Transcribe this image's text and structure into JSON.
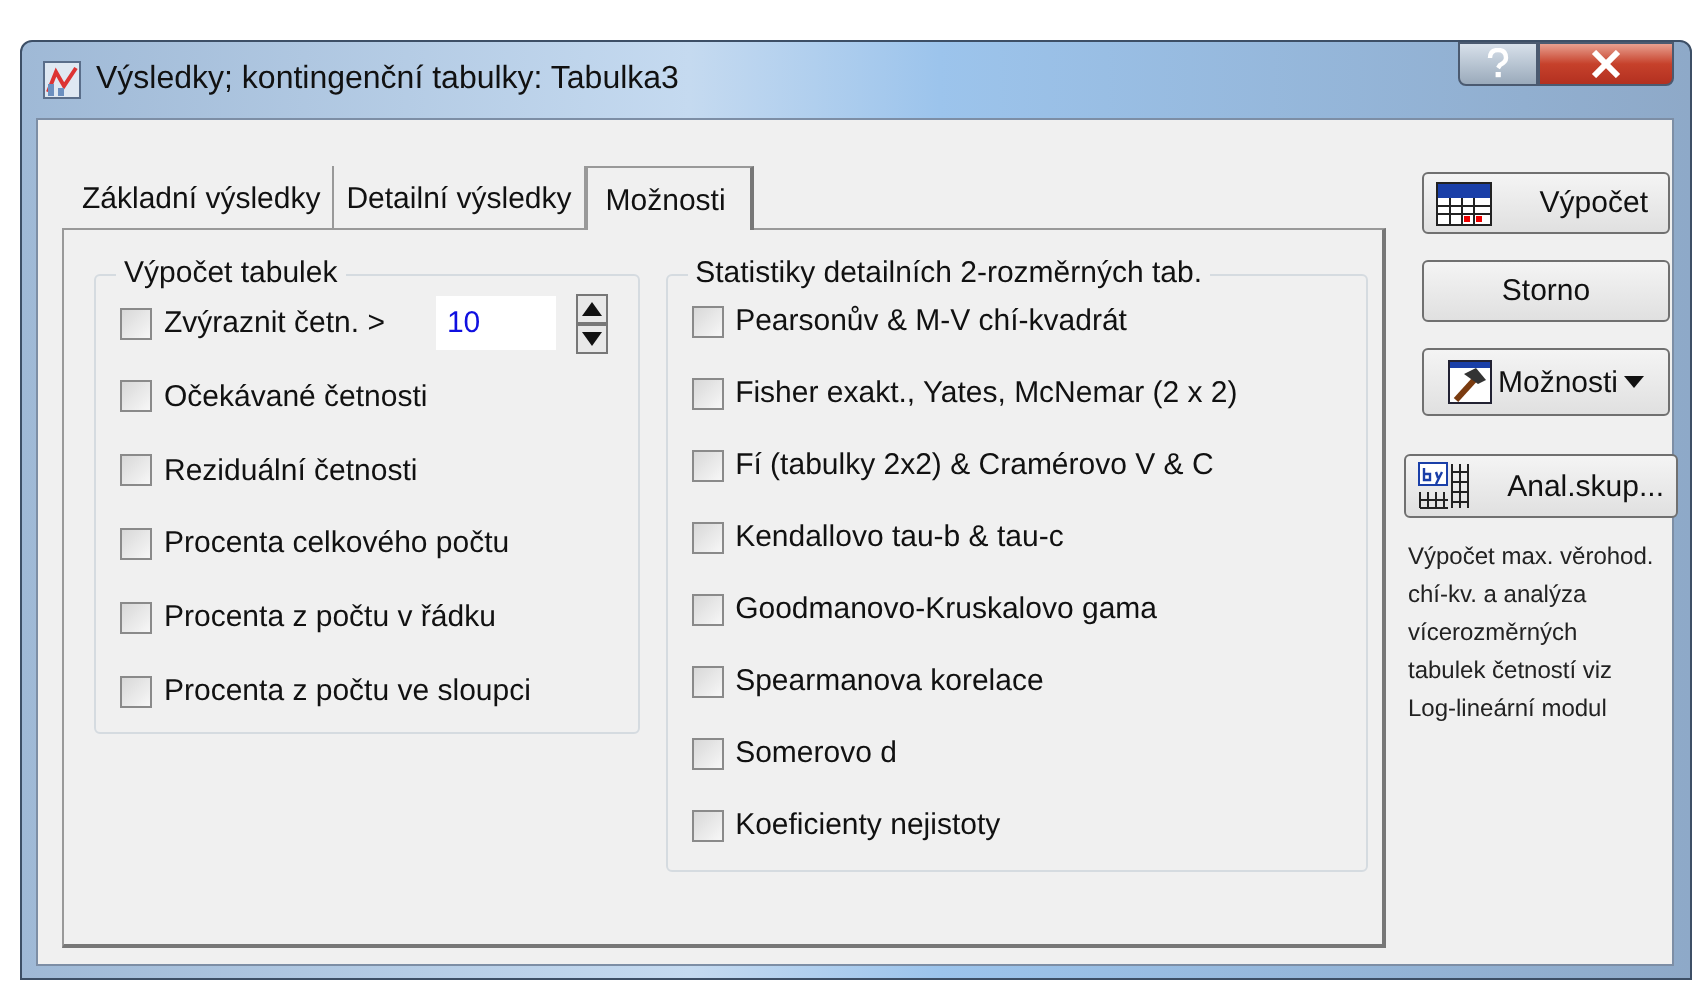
{
  "window": {
    "title": "Výsledky; kontingenční tabulky: Tabulka3"
  },
  "tabs": [
    {
      "label": "Základní výsledky",
      "selected": false
    },
    {
      "label": "Detailní výsledky",
      "selected": false
    },
    {
      "label": "Možnosti",
      "selected": true
    }
  ],
  "groups": [
    {
      "title": "Výpočet tabulek",
      "items": [
        {
          "kind": "threshold",
          "label": "Zvýraznit četn. >",
          "checked": false,
          "value": "10"
        },
        {
          "kind": "check",
          "label": "Očekávané četnosti",
          "checked": false
        },
        {
          "kind": "check",
          "label": "Reziduální četnosti",
          "checked": false
        },
        {
          "kind": "check",
          "label": "Procenta celkového počtu",
          "checked": false
        },
        {
          "kind": "check",
          "label": "Procenta z počtu v řádku",
          "checked": false
        },
        {
          "kind": "check",
          "label": "Procenta z počtu ve sloupci",
          "checked": false
        }
      ]
    },
    {
      "title": "Statistiky detailních 2-rozměrných tab.",
      "items": [
        {
          "kind": "check",
          "label": "Pearsonův & M-V chí-kvadrát",
          "checked": false
        },
        {
          "kind": "check",
          "label": "Fisher exakt., Yates, McNemar (2 x 2)",
          "checked": false
        },
        {
          "kind": "check",
          "label": "Fí (tabulky 2x2) & Cramérovo V & C",
          "checked": false
        },
        {
          "kind": "check",
          "label": "Kendallovo tau-b & tau-c",
          "checked": false
        },
        {
          "kind": "check",
          "label": "Goodmanovo-Kruskalovo gama",
          "checked": false
        },
        {
          "kind": "check",
          "label": "Spearmanova korelace",
          "checked": false
        },
        {
          "kind": "check",
          "label": "Somerovo d",
          "checked": false
        },
        {
          "kind": "check",
          "label": "Koeficienty nejistoty",
          "checked": false
        }
      ]
    }
  ],
  "buttons": [
    {
      "kind": "calc",
      "label": "Výpočet"
    },
    {
      "kind": "plain",
      "label": "Storno"
    },
    {
      "kind": "menu",
      "label": "Možnosti"
    },
    {
      "kind": "by",
      "label": "Anal.skup..."
    }
  ],
  "note": "Výpočet max. věrohod. chí-kv. a analýza vícerozměrných tabulek četností viz Log-lineární modul"
}
